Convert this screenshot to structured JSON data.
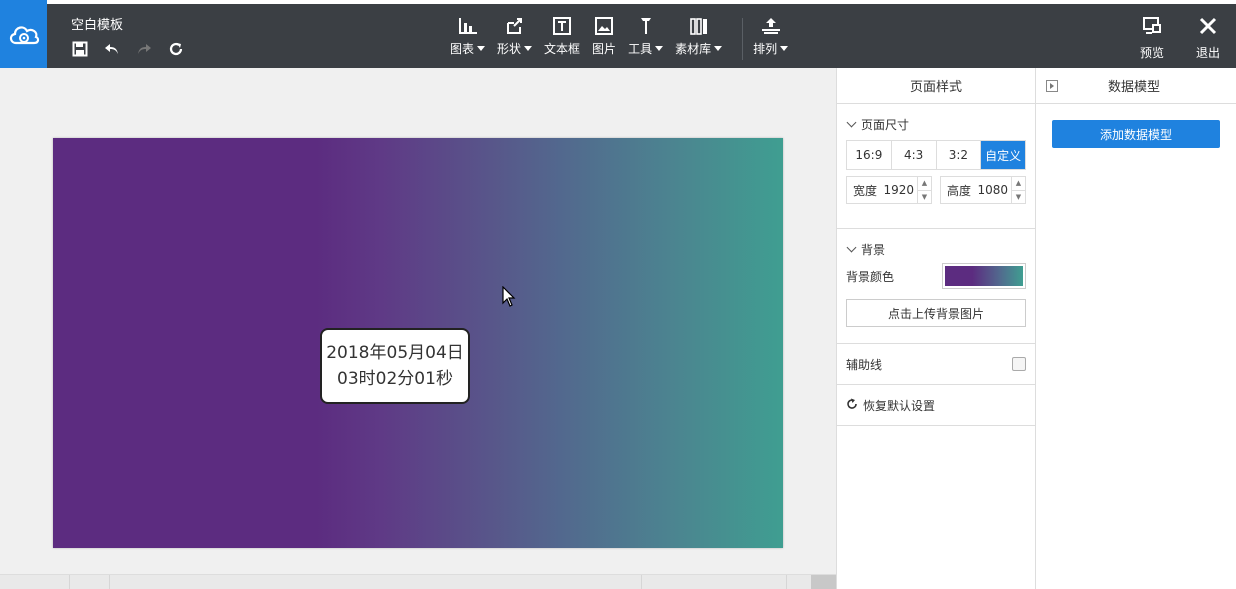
{
  "header": {
    "title": "空白模板",
    "toolbar": [
      {
        "label": "图表",
        "icon": "chart-icon",
        "dropdown": true
      },
      {
        "label": "形状",
        "icon": "shape-icon",
        "dropdown": true
      },
      {
        "label": "文本框",
        "icon": "textbox-icon",
        "dropdown": false
      },
      {
        "label": "图片",
        "icon": "image-icon",
        "dropdown": false
      },
      {
        "label": "工具",
        "icon": "tools-icon",
        "dropdown": true
      },
      {
        "label": "素材库",
        "icon": "library-icon",
        "dropdown": true
      },
      {
        "label": "排列",
        "icon": "arrange-icon",
        "dropdown": true
      }
    ],
    "preview_label": "预览",
    "exit_label": "退出"
  },
  "canvas": {
    "date_line1": "2018年05月04日",
    "date_line2": "03时02分01秒",
    "gradient_colors": [
      "#5c2c80",
      "#52698e",
      "#3f9e91"
    ]
  },
  "page_style": {
    "header": "页面样式",
    "size_section": "页面尺寸",
    "ratios": [
      "16:9",
      "4:3",
      "3:2",
      "自定义"
    ],
    "active_ratio": "自定义",
    "width_label": "宽度",
    "width_value": "1920",
    "height_label": "高度",
    "height_value": "1080",
    "bg_section": "背景",
    "bg_color_label": "背景颜色",
    "upload_label": "点击上传背景图片",
    "guides_label": "辅助线",
    "reset_label": "恢复默认设置"
  },
  "data_model": {
    "header": "数据模型",
    "add_label": "添加数据模型"
  },
  "colors": {
    "accent": "#1f82df",
    "topbar": "#3b3f44"
  }
}
